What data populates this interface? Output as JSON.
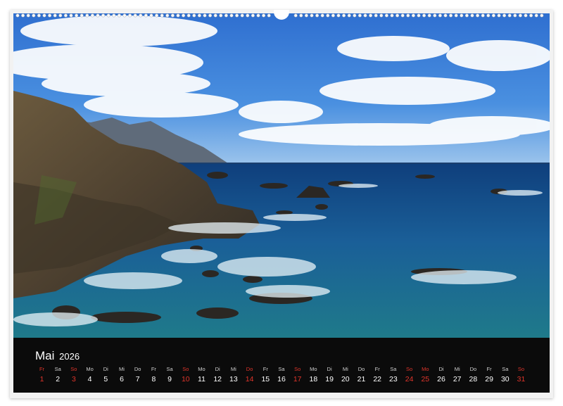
{
  "calendar": {
    "month": "Mai",
    "year": "2026",
    "accent_color": "#e0352b",
    "days": [
      {
        "dow": "Fr",
        "num": "1",
        "highlight": true
      },
      {
        "dow": "Sa",
        "num": "2",
        "highlight": false
      },
      {
        "dow": "So",
        "num": "3",
        "highlight": true
      },
      {
        "dow": "Mo",
        "num": "4",
        "highlight": false
      },
      {
        "dow": "Di",
        "num": "5",
        "highlight": false
      },
      {
        "dow": "Mi",
        "num": "6",
        "highlight": false
      },
      {
        "dow": "Do",
        "num": "7",
        "highlight": false
      },
      {
        "dow": "Fr",
        "num": "8",
        "highlight": false
      },
      {
        "dow": "Sa",
        "num": "9",
        "highlight": false
      },
      {
        "dow": "So",
        "num": "10",
        "highlight": true
      },
      {
        "dow": "Mo",
        "num": "11",
        "highlight": false
      },
      {
        "dow": "Di",
        "num": "12",
        "highlight": false
      },
      {
        "dow": "Mi",
        "num": "13",
        "highlight": false
      },
      {
        "dow": "Do",
        "num": "14",
        "highlight": true
      },
      {
        "dow": "Fr",
        "num": "15",
        "highlight": false
      },
      {
        "dow": "Sa",
        "num": "16",
        "highlight": false
      },
      {
        "dow": "So",
        "num": "17",
        "highlight": true
      },
      {
        "dow": "Mo",
        "num": "18",
        "highlight": false
      },
      {
        "dow": "Di",
        "num": "19",
        "highlight": false
      },
      {
        "dow": "Mi",
        "num": "20",
        "highlight": false
      },
      {
        "dow": "Do",
        "num": "21",
        "highlight": false
      },
      {
        "dow": "Fr",
        "num": "22",
        "highlight": false
      },
      {
        "dow": "Sa",
        "num": "23",
        "highlight": false
      },
      {
        "dow": "So",
        "num": "24",
        "highlight": true
      },
      {
        "dow": "Mo",
        "num": "25",
        "highlight": true
      },
      {
        "dow": "Di",
        "num": "26",
        "highlight": false
      },
      {
        "dow": "Mi",
        "num": "27",
        "highlight": false
      },
      {
        "dow": "Do",
        "num": "28",
        "highlight": false
      },
      {
        "dow": "Fr",
        "num": "29",
        "highlight": false
      },
      {
        "dow": "Sa",
        "num": "30",
        "highlight": false
      },
      {
        "dow": "So",
        "num": "31",
        "highlight": true
      }
    ]
  }
}
